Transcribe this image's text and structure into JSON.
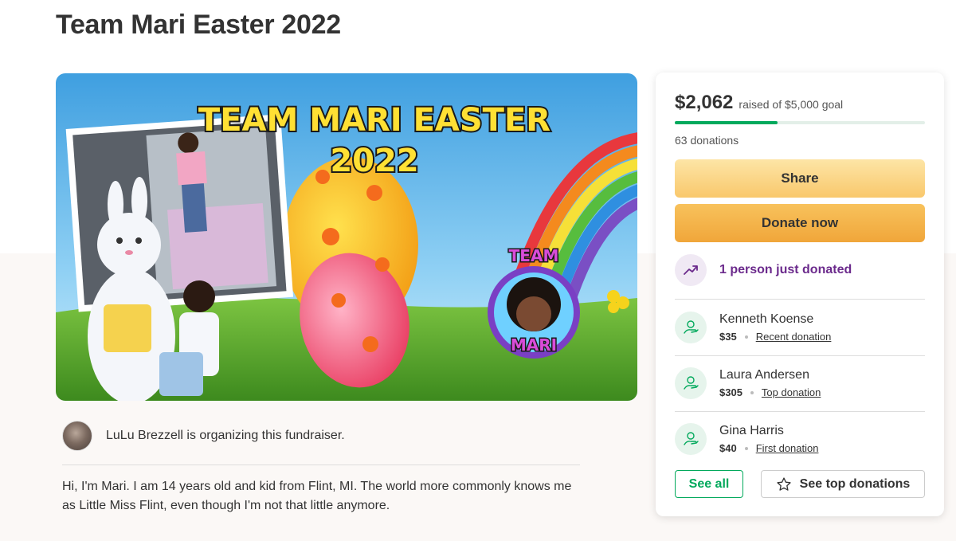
{
  "page": {
    "title": "Team Mari Easter 2022"
  },
  "hero": {
    "banner_line1": "TEAM MARI EASTER",
    "banner_line2": "2022",
    "badge_top": "TEAM",
    "badge_bottom": "MARI"
  },
  "organizer": {
    "text": "LuLu Brezzell is organizing this fundraiser."
  },
  "story": {
    "text": "Hi, I'm Mari. I am 14 years old and kid from Flint, MI. The world more commonly knows me as Little Miss Flint, even though I'm not that little anymore."
  },
  "card": {
    "raised": "$2,062",
    "goal_text": "raised of $5,000 goal",
    "progress_fraction": 0.41,
    "donations": "63 donations",
    "share_label": "Share",
    "donate_label": "Donate now",
    "recent_text": "1 person just donated",
    "donors": [
      {
        "name": "Kenneth Koense",
        "amount": "$35",
        "tag": "Recent donation"
      },
      {
        "name": "Laura Andersen",
        "amount": "$305",
        "tag": "Top donation"
      },
      {
        "name": "Gina Harris",
        "amount": "$40",
        "tag": "First donation"
      }
    ],
    "see_all_label": "See all",
    "see_top_label": "See top donations"
  },
  "colors": {
    "brand_green": "#02a95c",
    "purple": "#6b2a8c",
    "share_yellow": "#f9c86c",
    "donate_orange": "#f0a63a"
  },
  "icons": [
    "trend-up-icon",
    "donor-hand-icon",
    "star-icon"
  ]
}
